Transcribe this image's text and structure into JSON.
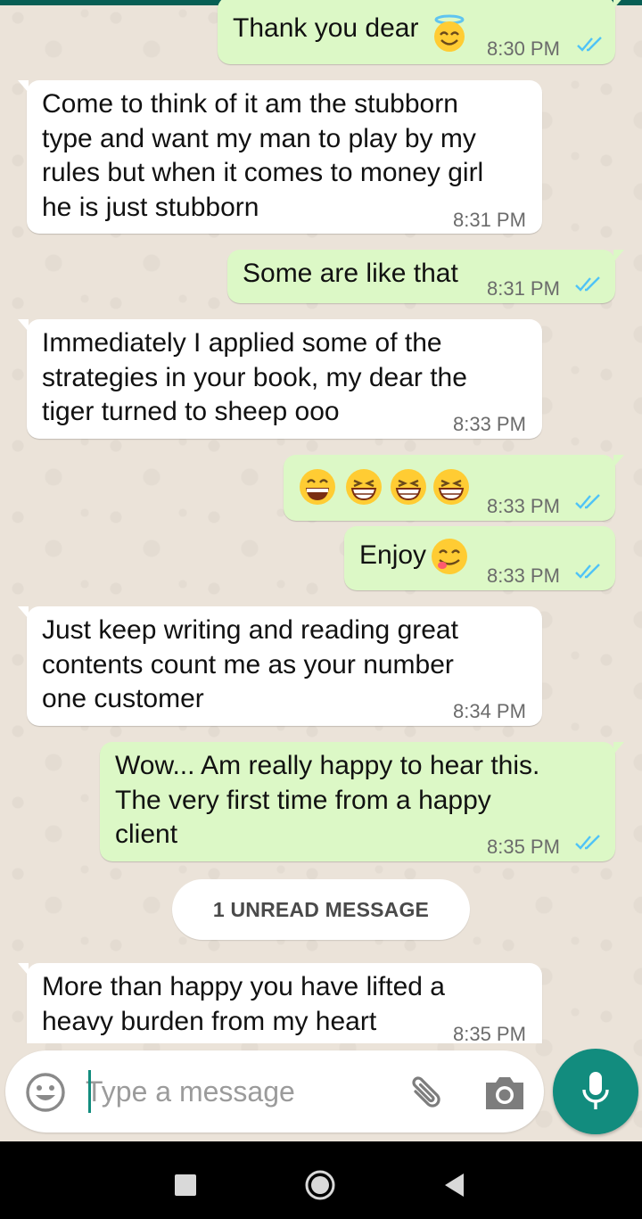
{
  "conversation": {
    "messages": [
      {
        "direction": "out",
        "text": "Thank you dear",
        "emoji": "smiling-face-with-halo",
        "time": "8:30 PM",
        "status": "read"
      },
      {
        "direction": "in",
        "text": "Come to think of it am the stubborn\ntype and want my man to play by my\nrules but when it comes to money girl\nhe is just stubborn",
        "time": "8:31 PM"
      },
      {
        "direction": "out",
        "text": "Some are like that",
        "time": "8:31 PM",
        "status": "read"
      },
      {
        "direction": "in",
        "text": "Immediately I applied some of the\nstrategies in your book, my dear the\ntiger turned to sheep ooo",
        "time": "8:33 PM"
      },
      {
        "direction": "out",
        "emoji_sequence": [
          "grinning-face-with-smiling-eyes",
          "beaming-face",
          "beaming-face",
          "beaming-face"
        ],
        "time": "8:33 PM",
        "status": "read"
      },
      {
        "direction": "out",
        "text": "Enjoy",
        "emoji": "face-savoring-food",
        "time": "8:33 PM",
        "status": "read"
      },
      {
        "direction": "in",
        "text": "Just keep writing and reading great\ncontents count me as your number\none customer",
        "time": "8:34 PM"
      },
      {
        "direction": "out",
        "text": "Wow... Am really happy to hear this.\nThe very first  time from a happy\nclient",
        "time": "8:35 PM",
        "status": "read"
      },
      {
        "direction": "in",
        "text": "More than happy you have lifted a\nheavy burden from my heart",
        "time": "8:35 PM"
      }
    ],
    "unread_banner": "1 UNREAD MESSAGE"
  },
  "input": {
    "placeholder": "Type a message",
    "icons": [
      "emoji-icon",
      "attach-icon",
      "camera-icon",
      "mic-icon"
    ]
  },
  "navigation": {
    "icons": [
      "recents-icon",
      "home-icon",
      "back-icon"
    ]
  },
  "colors": {
    "incoming_bubble": "#ffffff",
    "outgoing_bubble": "#dcf8c6",
    "accent": "#128c7e",
    "read_ticks": "#4fc3f7",
    "wallpaper": "#ebe3d9"
  }
}
